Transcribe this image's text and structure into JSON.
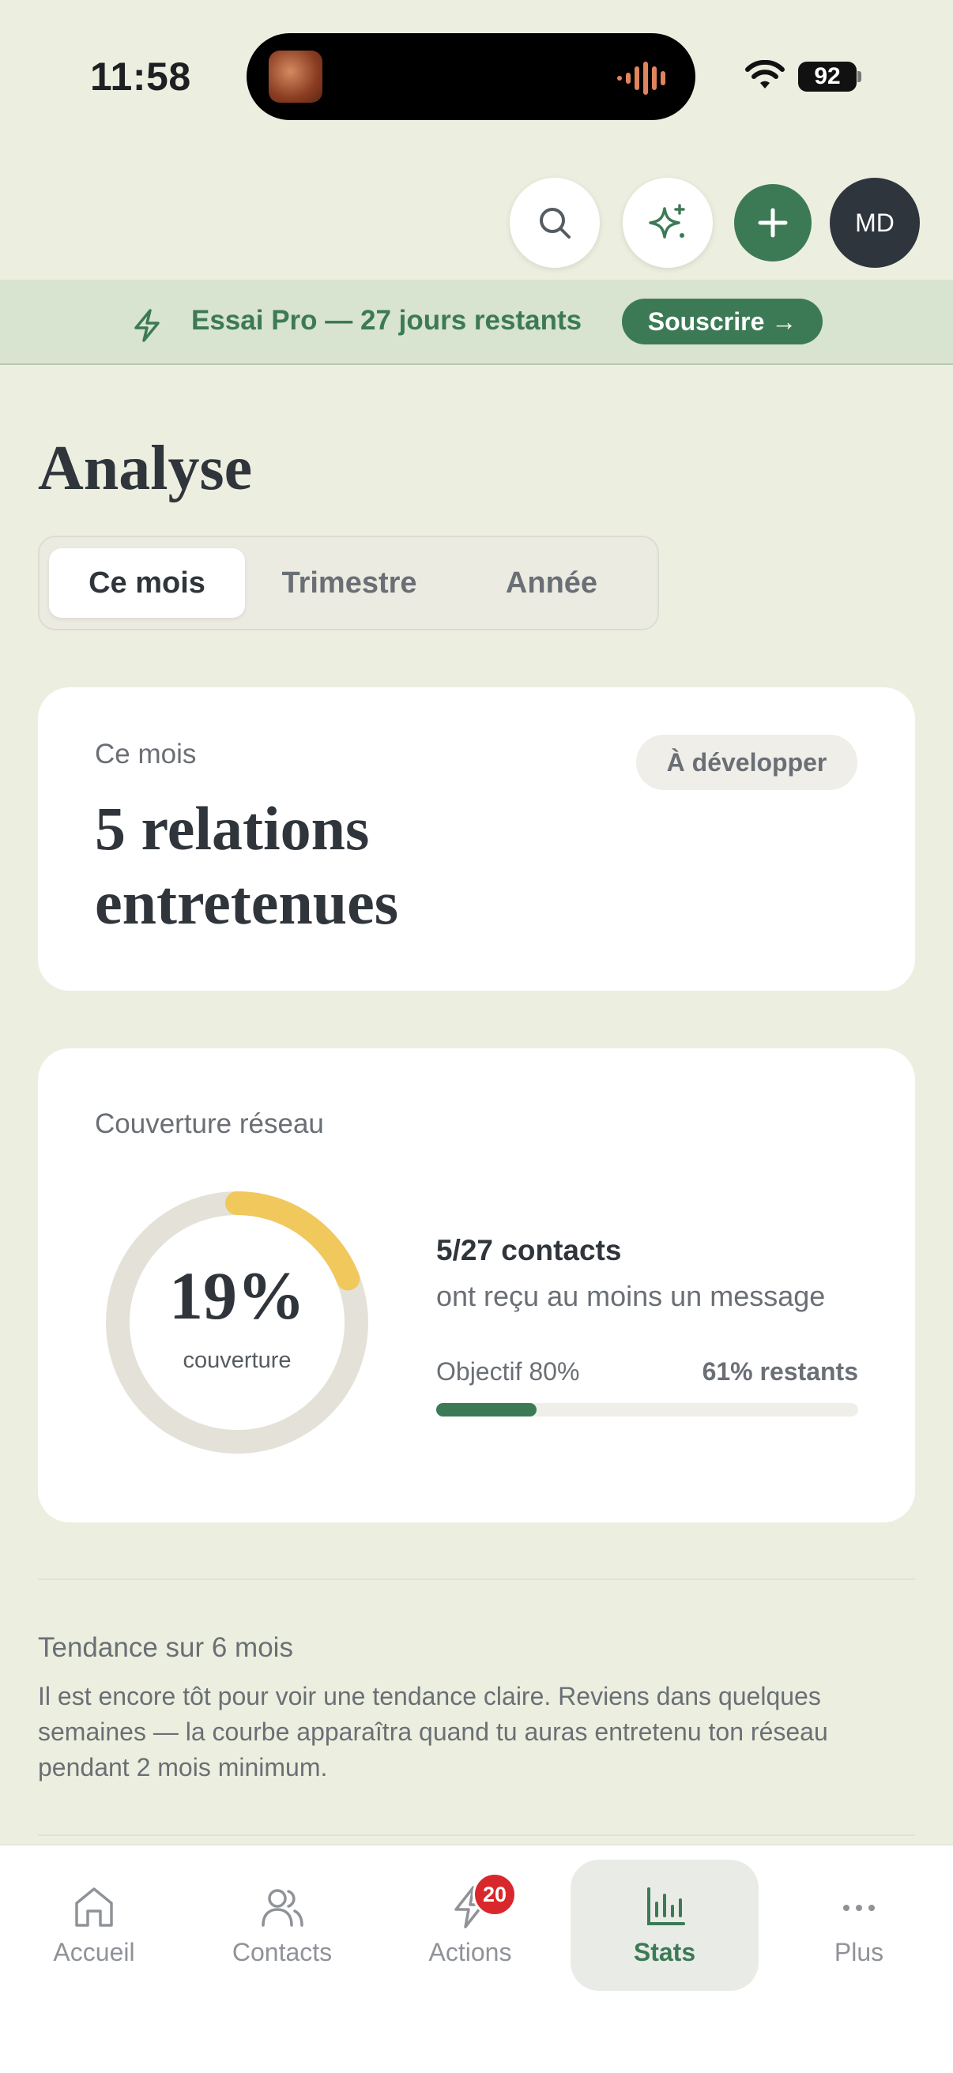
{
  "status_bar": {
    "time": "11:58",
    "battery": "92"
  },
  "header": {
    "avatar_initials": "MD"
  },
  "trial_banner": {
    "text": "Essai Pro — 27 jours restants",
    "button": "Souscrire →"
  },
  "page": {
    "title": "Analyse"
  },
  "period_tabs": [
    {
      "label": "Ce mois",
      "active": true
    },
    {
      "label": "Trimestre",
      "active": false
    },
    {
      "label": "Année",
      "active": false
    }
  ],
  "month_card": {
    "label": "Ce mois",
    "headline_line1": "5 relations",
    "headline_line2": "entretenues",
    "badge": "À développer"
  },
  "coverage_card": {
    "title": "Couverture réseau",
    "percent_text": "19%",
    "percent_value": 19,
    "ring_caption": "couverture",
    "contacts": "5/27 contacts",
    "contacts_sub": "ont reçu au moins un message",
    "goal_label": "Objectif 80%",
    "remaining": "61% restants",
    "goal_progress_fraction": 0.2375
  },
  "trend": {
    "title": "Tendance sur 6 mois",
    "text": "Il est encore tôt pour voir une tendance claire. Reviens dans quelques semaines — la courbe apparaîtra quand tu auras entretenu ton réseau pendant 2 mois minimum."
  },
  "tabbar": {
    "items": [
      {
        "label": "Accueil",
        "icon": "home-icon"
      },
      {
        "label": "Contacts",
        "icon": "users-icon"
      },
      {
        "label": "Actions",
        "icon": "bolt-icon",
        "badge": "20"
      },
      {
        "label": "Stats",
        "icon": "bar-chart-icon",
        "active": true
      },
      {
        "label": "Plus",
        "icon": "more-icon"
      }
    ]
  },
  "colors": {
    "accent": "#3c7a56",
    "ring_progress": "#f0c85c",
    "background": "#ecefdf",
    "badge_red": "#d8282c"
  }
}
